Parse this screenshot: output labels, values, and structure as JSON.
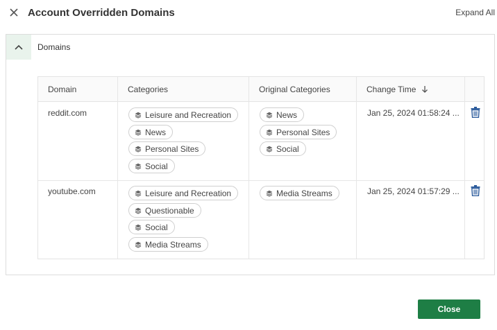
{
  "header": {
    "title": "Account Overridden Domains",
    "expand_all": "Expand All"
  },
  "panel": {
    "title": "Domains"
  },
  "table": {
    "columns": [
      "Domain",
      "Categories",
      "Original Categories",
      "Change Time"
    ],
    "rows": [
      {
        "domain": "reddit.com",
        "categories": [
          "Leisure and Recreation",
          "News",
          "Personal Sites",
          "Social"
        ],
        "original_categories": [
          "News",
          "Personal Sites",
          "Social"
        ],
        "change_time": "Jan 25, 2024 01:58:24 ..."
      },
      {
        "domain": "youtube.com",
        "categories": [
          "Leisure and Recreation",
          "Questionable",
          "Social",
          "Media Streams"
        ],
        "original_categories": [
          "Media Streams"
        ],
        "change_time": "Jan 25, 2024 01:57:29 ..."
      }
    ]
  },
  "footer": {
    "close_label": "Close"
  },
  "colors": {
    "accent": "#1e7e45",
    "trash": "#2a5a9b",
    "panel_toggle_bg": "#e9f3ec"
  }
}
